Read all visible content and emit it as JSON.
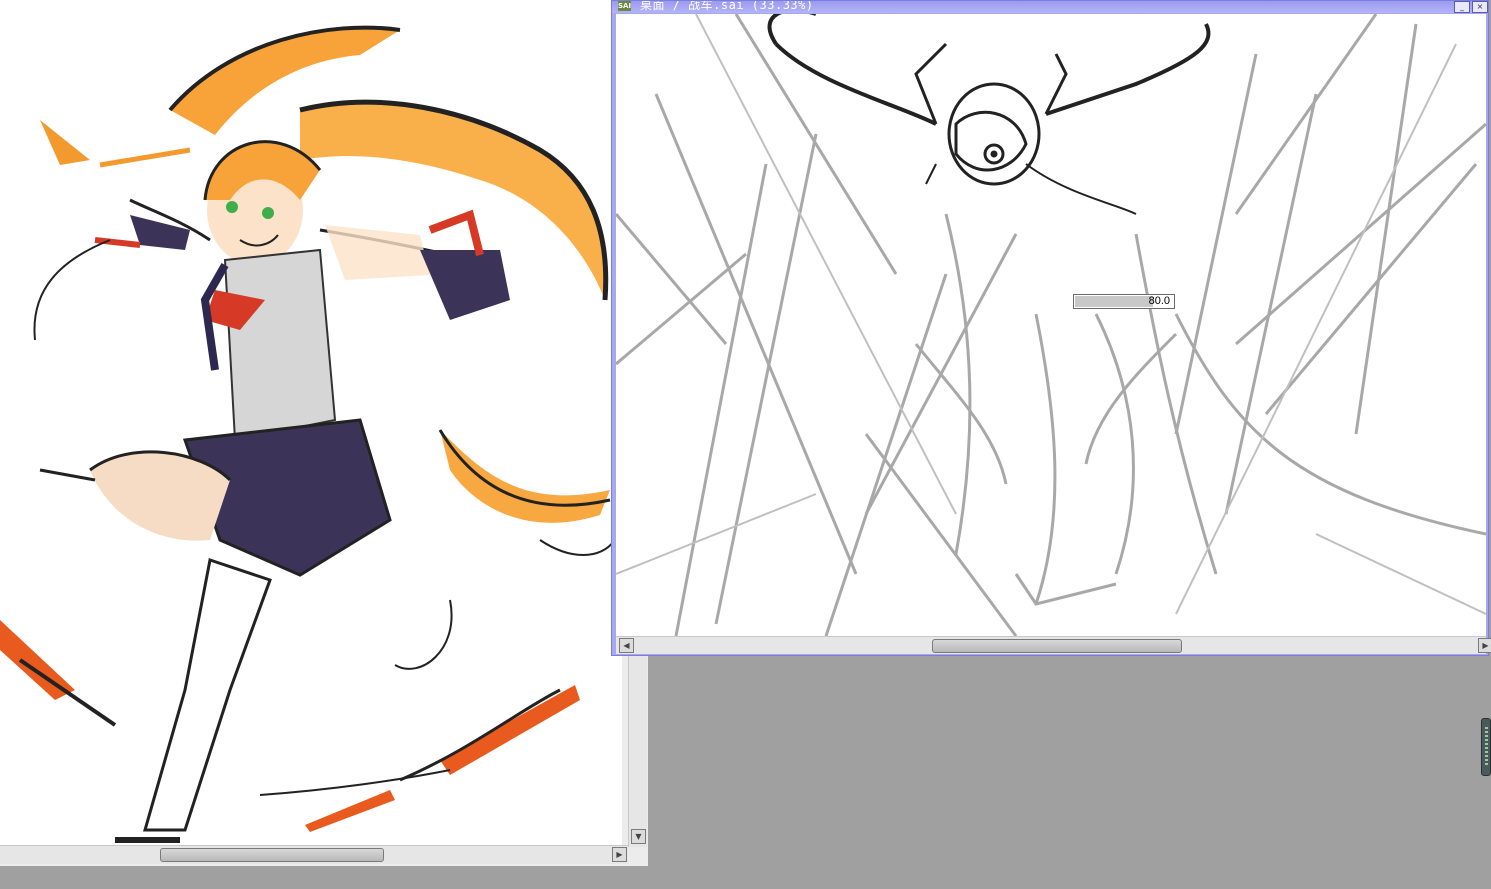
{
  "right_window": {
    "title": "桌面 / 战车.sai (33.33%)",
    "app_icon": "SAI",
    "minimize_icon": "minimize-icon",
    "close_icon": "close-icon"
  },
  "brush_opacity": {
    "value": "80.0",
    "fraction": 0.8
  },
  "scrollbars": {
    "left_arrow_icon": "◀",
    "right_arrow_icon": "▶",
    "down_arrow_icon": "▼"
  },
  "colors": {
    "title_bar": "#a8a8f0",
    "workspace": "#a0a0a0",
    "hair_orange": "#f39a2e",
    "uniform_navy": "#3c3458",
    "accent_red": "#d63a26"
  }
}
